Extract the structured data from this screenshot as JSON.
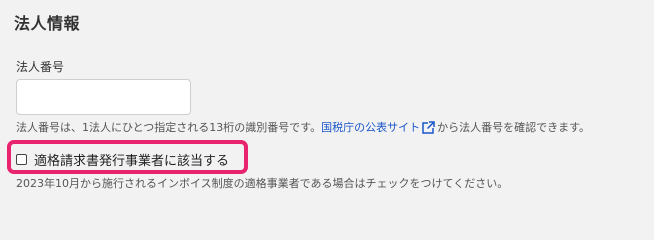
{
  "section": {
    "title": "法人情報"
  },
  "corporate_number": {
    "label": "法人番号",
    "value": "",
    "placeholder": "",
    "help_before": "法人番号は、1法人にひとつ指定される13桁の識別番号です。",
    "help_link": "国税庁の公表サイト",
    "help_after": "から法人番号を確認できます。",
    "link_icon": "external-link-icon"
  },
  "invoice_issuer": {
    "label": "適格請求書発行事業者に該当する",
    "checked": false,
    "help": "2023年10月から施行されるインボイス制度の適格事業者である場合はチェックをつけてください。"
  },
  "colors": {
    "background": "#f2f2f2",
    "link": "#1a56c9",
    "highlight": "#e8246e"
  }
}
